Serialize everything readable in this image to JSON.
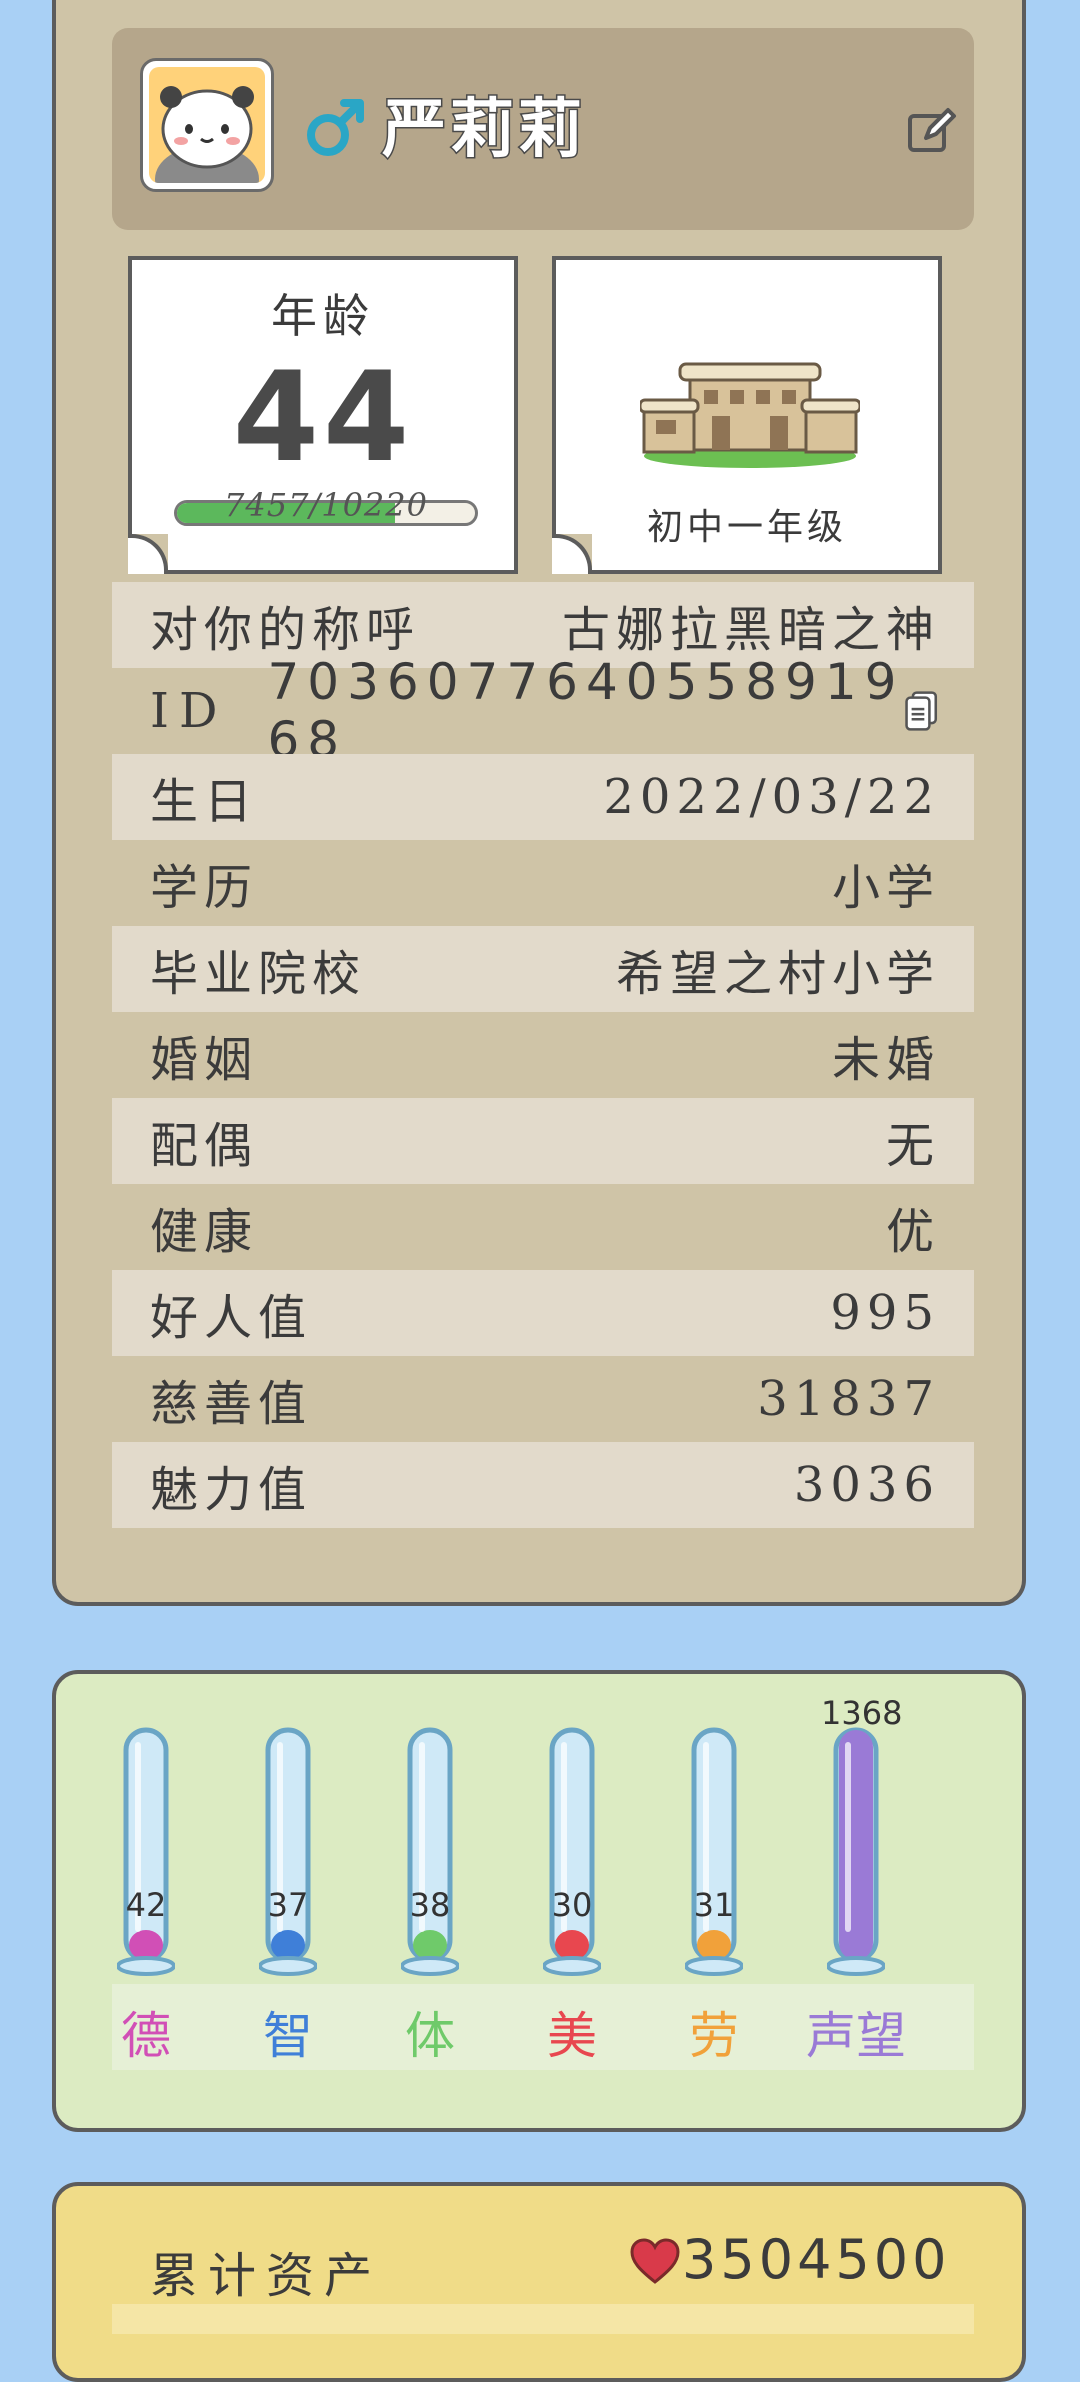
{
  "profile": {
    "name": "严莉莉",
    "gender_icon": "male-symbol-icon",
    "avatar_icon": "panda-avatar-icon",
    "edit_icon": "edit-pencil-icon",
    "age_label": "年龄",
    "age_value": "44",
    "exp_text": "7457/10220",
    "exp_progress": 0.73,
    "grade": "初中一年级",
    "school_image_icon": "school-building-icon"
  },
  "rows": [
    {
      "label": "对你的称呼",
      "value": "古娜拉黑暗之神"
    },
    {
      "label": "ID",
      "value": "7036077640558919 68",
      "id": true
    },
    {
      "label": "生日",
      "value": "2022/03/22"
    },
    {
      "label": "学历",
      "value": "小学"
    },
    {
      "label": "毕业院校",
      "value": "希望之村小学"
    },
    {
      "label": "婚姻",
      "value": "未婚"
    },
    {
      "label": "配偶",
      "value": "无"
    },
    {
      "label": "健康",
      "value": "优"
    },
    {
      "label": "好人值",
      "value": "995"
    },
    {
      "label": "慈善值",
      "value": "31837"
    },
    {
      "label": "魅力值",
      "value": "3036"
    }
  ],
  "id_value": "7036077640558919 68",
  "stats": [
    {
      "label": "德",
      "value": "42",
      "color": "#d14fb6",
      "fill": 0.12
    },
    {
      "label": "智",
      "value": "37",
      "color": "#3f7fd8",
      "fill": 0.11
    },
    {
      "label": "体",
      "value": "38",
      "color": "#6fca6a",
      "fill": 0.11
    },
    {
      "label": "美",
      "value": "30",
      "color": "#e8474f",
      "fill": 0.1
    },
    {
      "label": "劳",
      "value": "31",
      "color": "#f1a13a",
      "fill": 0.1
    },
    {
      "label": "声望",
      "value": "1368",
      "color": "#9a7ad6",
      "fill": 1.0
    }
  ],
  "assets": {
    "label": "累计资产",
    "value": "3504500",
    "icon": "heart-icon"
  }
}
